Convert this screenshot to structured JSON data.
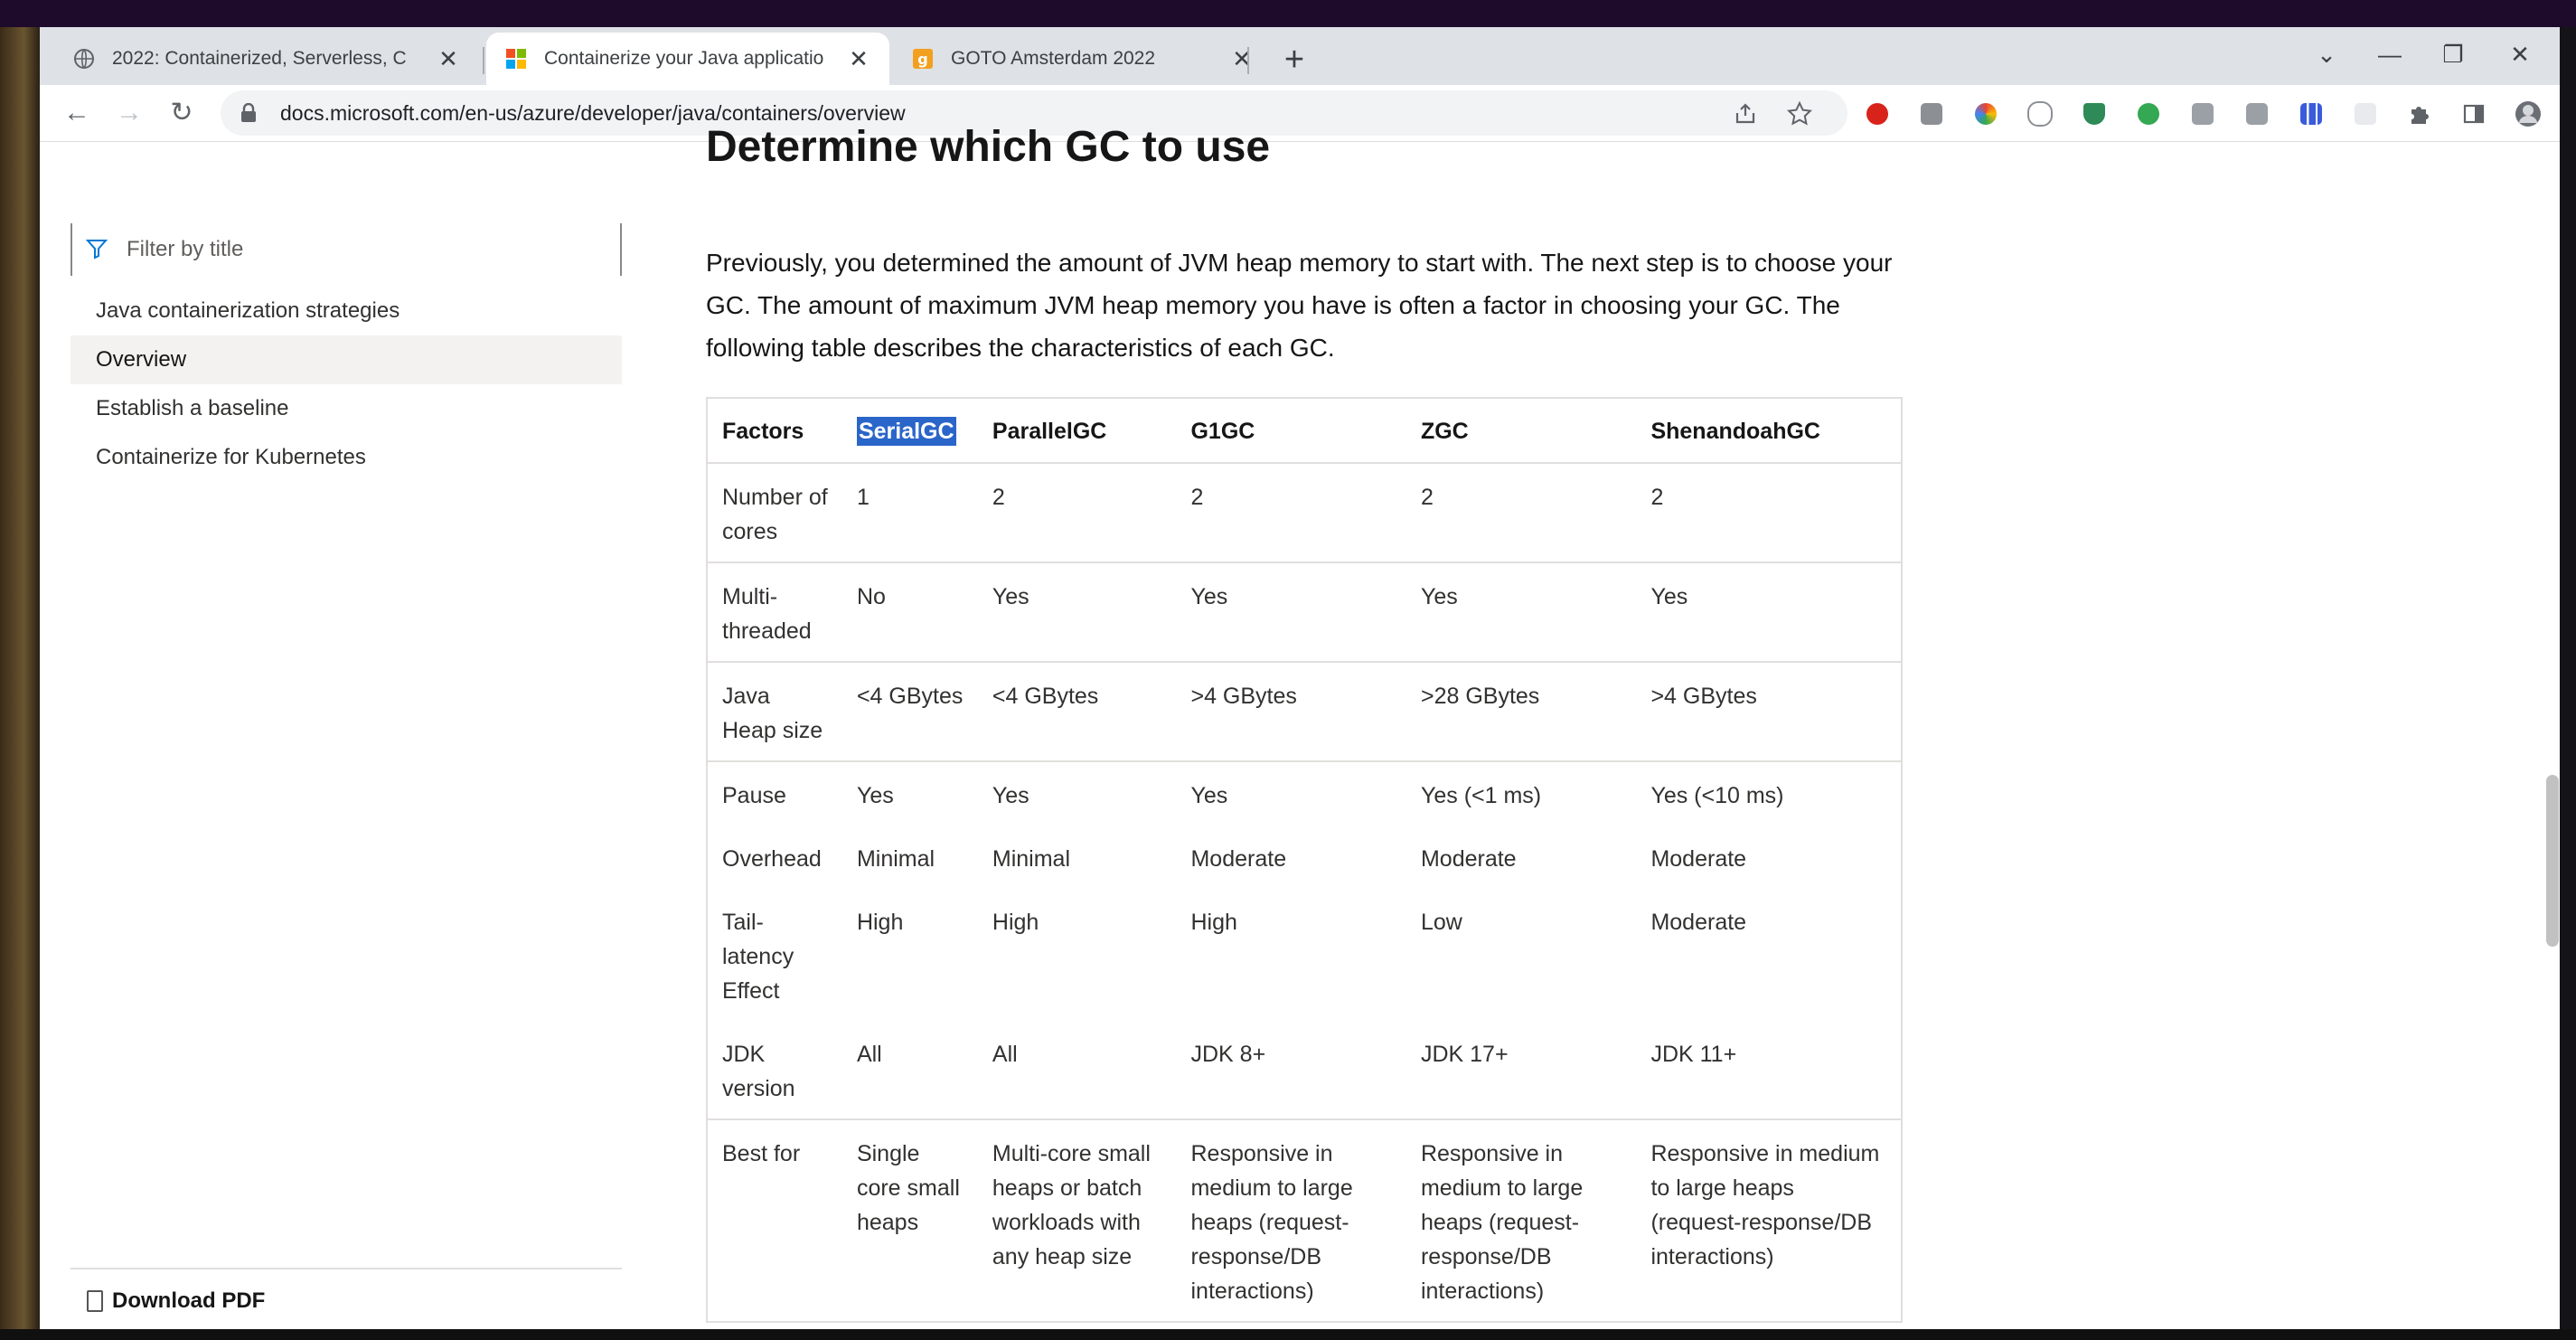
{
  "browser": {
    "tabs": [
      {
        "title": "2022: Containerized, Serverless, C",
        "active": false
      },
      {
        "title": "Containerize your Java applicatio",
        "active": true
      },
      {
        "title": "GOTO Amsterdam 2022",
        "active": false
      }
    ],
    "new_tab_label": "+",
    "tab_list_label": "⌄",
    "minimize_label": "—",
    "restore_label": "❐",
    "close_label": "✕",
    "back_label": "←",
    "forward_label": "→",
    "reload_label": "↻",
    "url": "docs.microsoft.com/en-us/azure/developer/java/containers/overview"
  },
  "sidebar": {
    "filter_placeholder": "Filter by title",
    "items": [
      {
        "label": "Java containerization strategies",
        "selected": false
      },
      {
        "label": "Overview",
        "selected": true
      },
      {
        "label": "Establish a baseline",
        "selected": false
      },
      {
        "label": "Containerize for Kubernetes",
        "selected": false
      }
    ],
    "download_pdf": "Download PDF"
  },
  "main": {
    "heading": "Determine which GC to use",
    "intro": "Previously, you determined the amount of JVM heap memory to start with. The next step is to choose your GC. The amount of maximum JVM heap memory you have is often a factor in choosing your GC. The following table describes the characteristics of each GC."
  },
  "table": {
    "headers": [
      "Factors",
      "SerialGC",
      "ParallelGC",
      "G1GC",
      "ZGC",
      "ShenandoahGC"
    ],
    "rows": [
      {
        "cells": [
          "Number of cores",
          "1",
          "2",
          "2",
          "2",
          "2"
        ]
      },
      {
        "cells": [
          "Multi-threaded",
          "No",
          "Yes",
          "Yes",
          "Yes",
          "Yes"
        ]
      },
      {
        "cells": [
          "Java Heap size",
          "<4 GBytes",
          "<4 GBytes",
          ">4 GBytes",
          ">28 GBytes",
          ">4 GBytes"
        ]
      },
      {
        "cells": [
          "Pause",
          "Yes",
          "Yes",
          "Yes",
          "Yes (<1 ms)",
          "Yes (<10 ms)"
        ]
      },
      {
        "cells": [
          "Overhead",
          "Minimal",
          "Minimal",
          "Moderate",
          "Moderate",
          "Moderate"
        ]
      },
      {
        "cells": [
          "Tail-latency Effect",
          "High",
          "High",
          "High",
          "Low",
          "Moderate"
        ]
      },
      {
        "cells": [
          "JDK version",
          "All",
          "All",
          "JDK 8+",
          "JDK 17+",
          "JDK 11+"
        ]
      },
      {
        "cells": [
          "Best for",
          "Single core small heaps",
          "Multi-core small heaps or batch workloads with any heap size",
          "Responsive in medium to large heaps (request-response/DB interactions)",
          "Responsive in medium to large heaps (request-response/DB interactions)",
          "Responsive in medium to large heaps (request-response/DB interactions)"
        ]
      }
    ]
  },
  "colors": {
    "selection_highlight": "#2a66c9",
    "tab_strip": "#dee1e6",
    "accent_blue": "#0078d4"
  },
  "icons": [
    "globe-icon",
    "microsoft-logo-icon",
    "goto-logo-icon",
    "lock-icon",
    "share-icon",
    "bookmark-star-icon",
    "filter-icon",
    "pdf-icon",
    "extensions-puzzle-icon",
    "side-panel-icon",
    "profile-avatar-icon"
  ]
}
